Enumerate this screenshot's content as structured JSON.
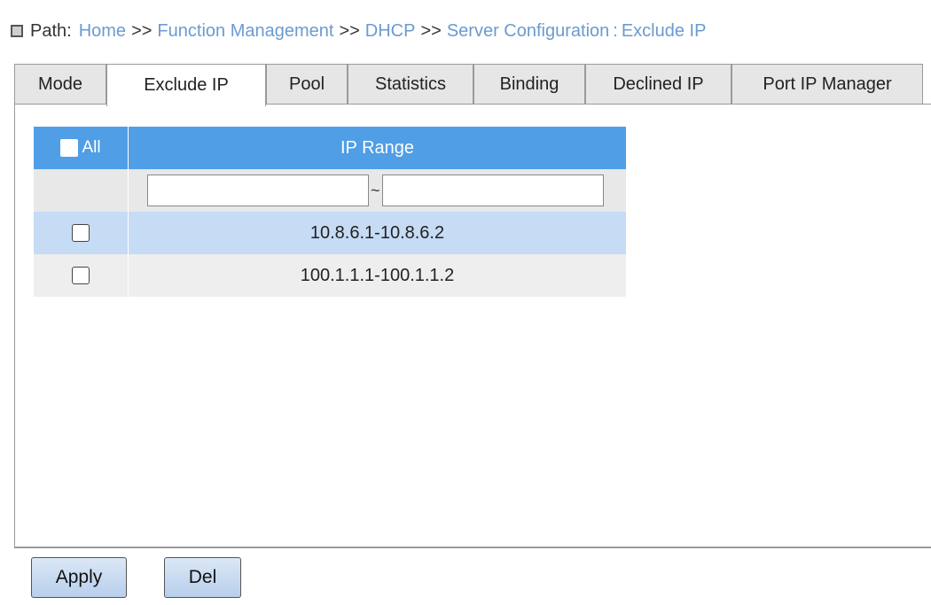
{
  "path": {
    "label": "Path:",
    "crumbs": [
      "Home",
      "Function Management",
      "DHCP",
      "Server Configuration"
    ],
    "separator": ">>",
    "colon": ":",
    "current": "Exclude IP"
  },
  "tabs": [
    {
      "label": "Mode",
      "active": false
    },
    {
      "label": "Exclude IP",
      "active": true
    },
    {
      "label": "Pool",
      "active": false
    },
    {
      "label": "Statistics",
      "active": false
    },
    {
      "label": "Binding",
      "active": false
    },
    {
      "label": "Declined IP",
      "active": false
    },
    {
      "label": "Port IP Manager",
      "active": false
    }
  ],
  "table": {
    "select_all_label": "All",
    "column_header": "IP Range",
    "filter": {
      "start_value": "",
      "range_separator": "~",
      "end_value": ""
    },
    "rows": [
      {
        "ip_range": "10.8.6.1-10.8.6.2",
        "checked": false
      },
      {
        "ip_range": "100.1.1.1-100.1.1.2",
        "checked": false
      }
    ]
  },
  "buttons": {
    "apply": "Apply",
    "del": "Del"
  },
  "colors": {
    "header_blue": "#4f9ee6",
    "crumb_link": "#6a9bd0",
    "row_selected": "#c6dbf4"
  }
}
